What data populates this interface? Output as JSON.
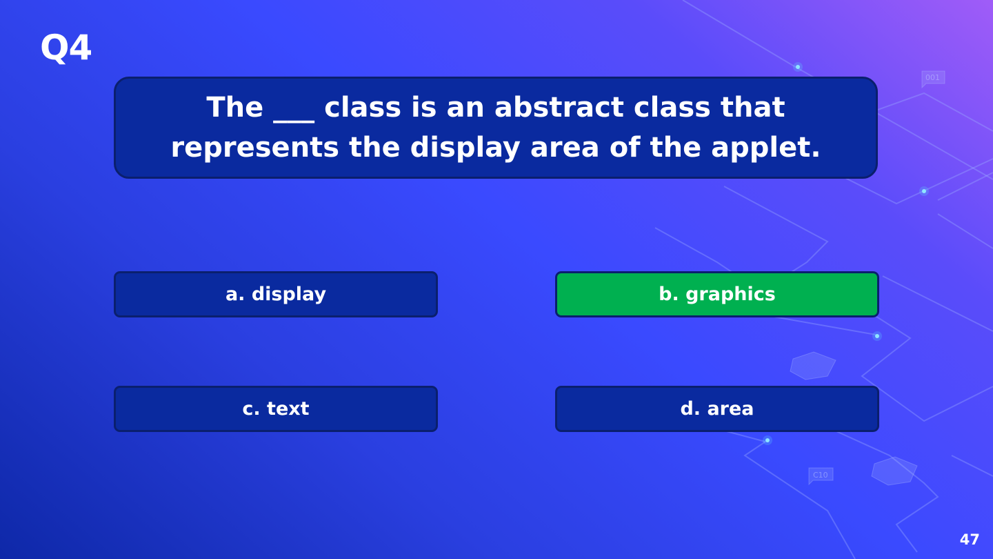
{
  "slide": {
    "question_number": "Q4",
    "question_line1": "The ___ class is an abstract class that",
    "question_line2": "represents the display area of the applet.",
    "options": [
      {
        "label": "a. display",
        "correct": false
      },
      {
        "label": "b. graphics",
        "correct": true
      },
      {
        "label": "c. text",
        "correct": false
      },
      {
        "label": "d. area",
        "correct": false
      }
    ],
    "page_number": "47",
    "decor_tags": [
      "001",
      "C10"
    ]
  },
  "colors": {
    "panel": "#0a2a9f",
    "panel_border": "#0a1f6e",
    "correct": "#00b050",
    "text": "#ffffff"
  }
}
